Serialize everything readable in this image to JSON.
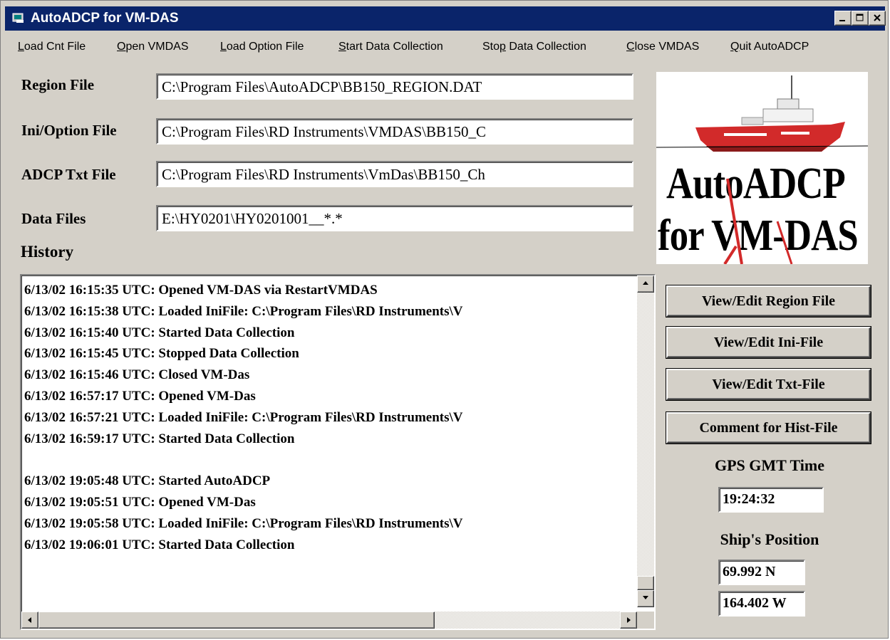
{
  "window": {
    "title": "AutoADCP for VM-DAS"
  },
  "menu": {
    "items": [
      {
        "pre": "",
        "key": "L",
        "post": "oad Cnt File"
      },
      {
        "pre": "",
        "key": "O",
        "post": "pen VMDAS"
      },
      {
        "pre": "",
        "key": "L",
        "post": "oad Option File"
      },
      {
        "pre": "",
        "key": "S",
        "post": "tart Data Collection"
      },
      {
        "pre": "Sto",
        "key": "p",
        "post": " Data Collection"
      },
      {
        "pre": "",
        "key": "C",
        "post": "lose VMDAS"
      },
      {
        "pre": "",
        "key": "Q",
        "post": "uit AutoADCP"
      }
    ]
  },
  "fields": {
    "region": {
      "label": "Region File",
      "value": "C:\\Program Files\\AutoADCP\\BB150_REGION.DAT"
    },
    "ini": {
      "label": "Ini/Option File",
      "value": "C:\\Program Files\\RD Instruments\\VMDAS\\BB150_C"
    },
    "adcp": {
      "label": "ADCP Txt File",
      "value": "C:\\Program Files\\RD Instruments\\VmDas\\BB150_Ch"
    },
    "data": {
      "label": "Data Files",
      "value": "E:\\HY0201\\HY0201001__*.*"
    }
  },
  "history": {
    "label": "History",
    "lines": [
      "6/13/02 16:15:35 UTC: Opened VM-DAS via RestartVMDAS",
      "6/13/02 16:15:38 UTC: Loaded IniFile: C:\\Program Files\\RD Instruments\\V",
      "6/13/02 16:15:40 UTC: Started Data Collection",
      "6/13/02 16:15:45 UTC: Stopped Data Collection",
      "6/13/02 16:15:46 UTC: Closed VM-Das",
      "6/13/02 16:57:17 UTC: Opened VM-Das",
      "6/13/02 16:57:21 UTC: Loaded IniFile: C:\\Program Files\\RD Instruments\\V",
      "6/13/02 16:59:17 UTC: Started Data Collection",
      "",
      "6/13/02 19:05:48 UTC: Started AutoADCP",
      "6/13/02 19:05:51 UTC: Opened VM-Das",
      "6/13/02 19:05:58 UTC: Loaded IniFile: C:\\Program Files\\RD Instruments\\V",
      "6/13/02 19:06:01 UTC: Started Data Collection"
    ]
  },
  "logo": {
    "line1": "AutoADCP",
    "line2": "for VM-DAS"
  },
  "buttons": {
    "region": "View/Edit Region File",
    "ini": "View/Edit Ini-File",
    "txt": "View/Edit Txt-File",
    "comment": "Comment for Hist-File"
  },
  "gps": {
    "label": "GPS GMT Time",
    "time": "19:24:32"
  },
  "position": {
    "label": "Ship's Position",
    "lat": "69.992 N",
    "lon": "164.402 W"
  }
}
